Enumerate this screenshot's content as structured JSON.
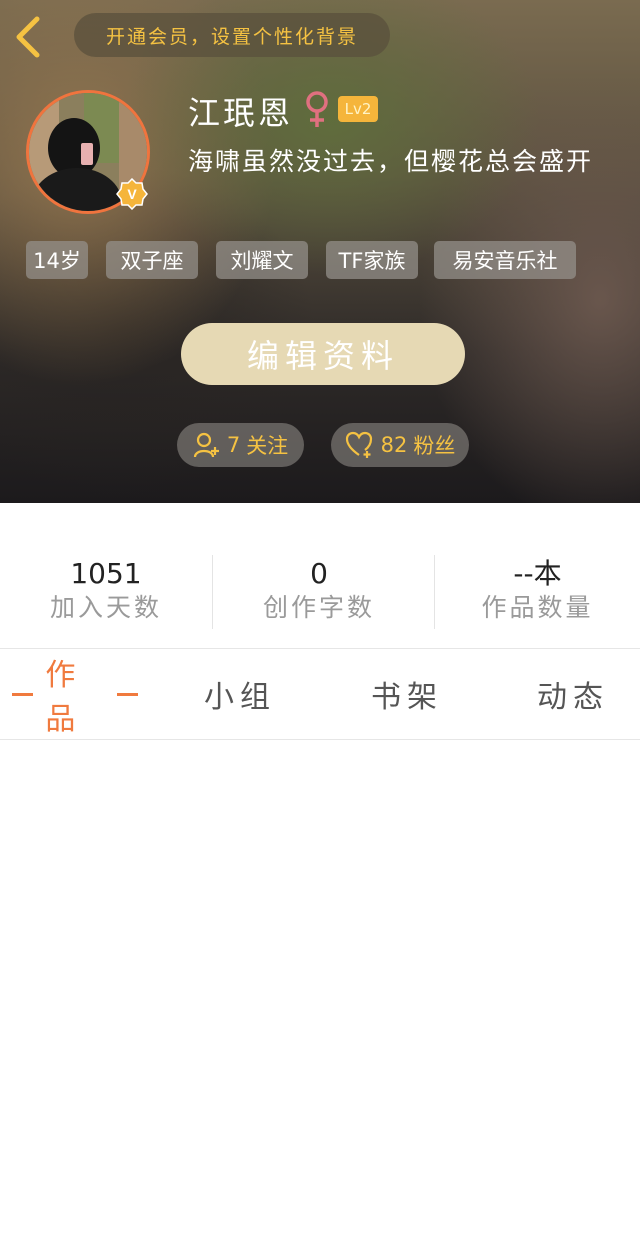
{
  "header": {
    "vip_banner": "开通会员，设置个性化背景",
    "username": "江珉恩",
    "gender": "female-symbol-icon",
    "level": "Lv2",
    "signature": "海啸虽然没过去，但樱花总会盛开",
    "verified_badge": "V",
    "tags": [
      "14岁",
      "双子座",
      "刘耀文",
      "TF家族",
      "易安音乐社"
    ],
    "edit_button": "编辑资料",
    "follow": {
      "count": "7",
      "label": "关注"
    },
    "fans": {
      "count": "82",
      "label": "粉丝"
    }
  },
  "stats": [
    {
      "value": "1051",
      "label": "加入天数"
    },
    {
      "value": "0",
      "label": "创作字数"
    },
    {
      "value": "--本",
      "label": "作品数量"
    }
  ],
  "tabs": [
    "作品",
    "小组",
    "书架",
    "动态"
  ],
  "colors": {
    "accent": "#f07a3e",
    "gold": "#f5c242",
    "level_badge": "#f5b53b",
    "edit_button": "#e6d9b4"
  }
}
